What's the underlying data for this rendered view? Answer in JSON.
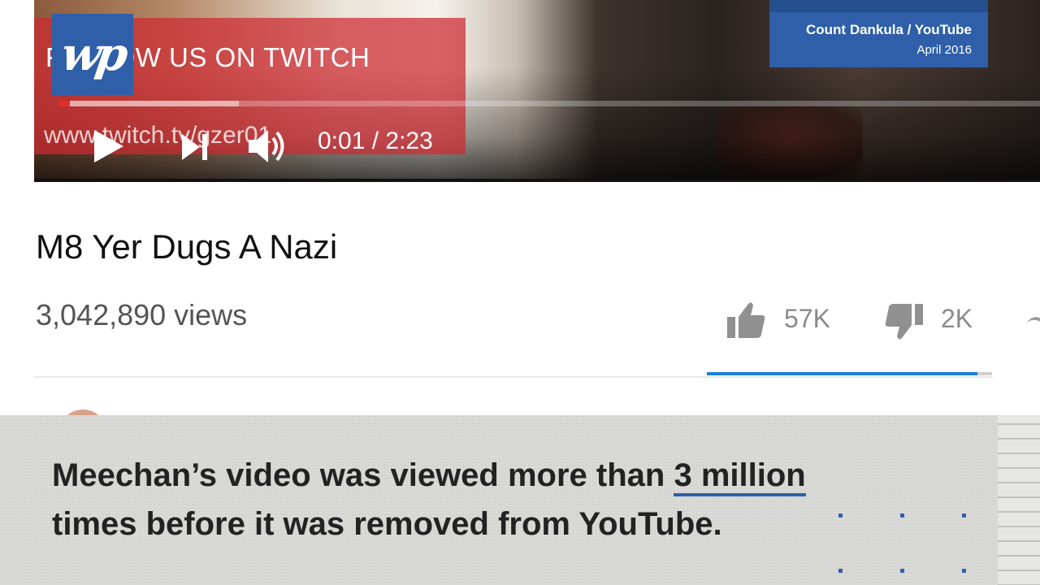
{
  "player": {
    "overlay_title": "FOLLOW US ON TWITCH",
    "overlay_url": "www.twitch.tv/gzer01",
    "time_display": "0:01 / 2:23",
    "progress_fraction": 0.01
  },
  "branding": {
    "logo_text": "wp",
    "credit_source": "Count Dankula / YouTube",
    "credit_date": "April 2016"
  },
  "video": {
    "title": "M8 Yer Dugs A Nazi",
    "views": "3,042,890 views",
    "likes": "57K",
    "dislikes": "2K",
    "like_ratio": 0.95
  },
  "caption": {
    "before": "Meechan’s video was viewed more than ",
    "highlight": "3 million",
    "after": " times before it was removed from YouTube."
  },
  "colors": {
    "brand_blue": "#2e5fa8",
    "youtube_red": "#e52d27",
    "like_bar_blue": "#1a7fd4"
  },
  "icons": [
    "play-icon",
    "skip-next-icon",
    "volume-icon",
    "thumbs-up-icon",
    "thumbs-down-icon"
  ]
}
